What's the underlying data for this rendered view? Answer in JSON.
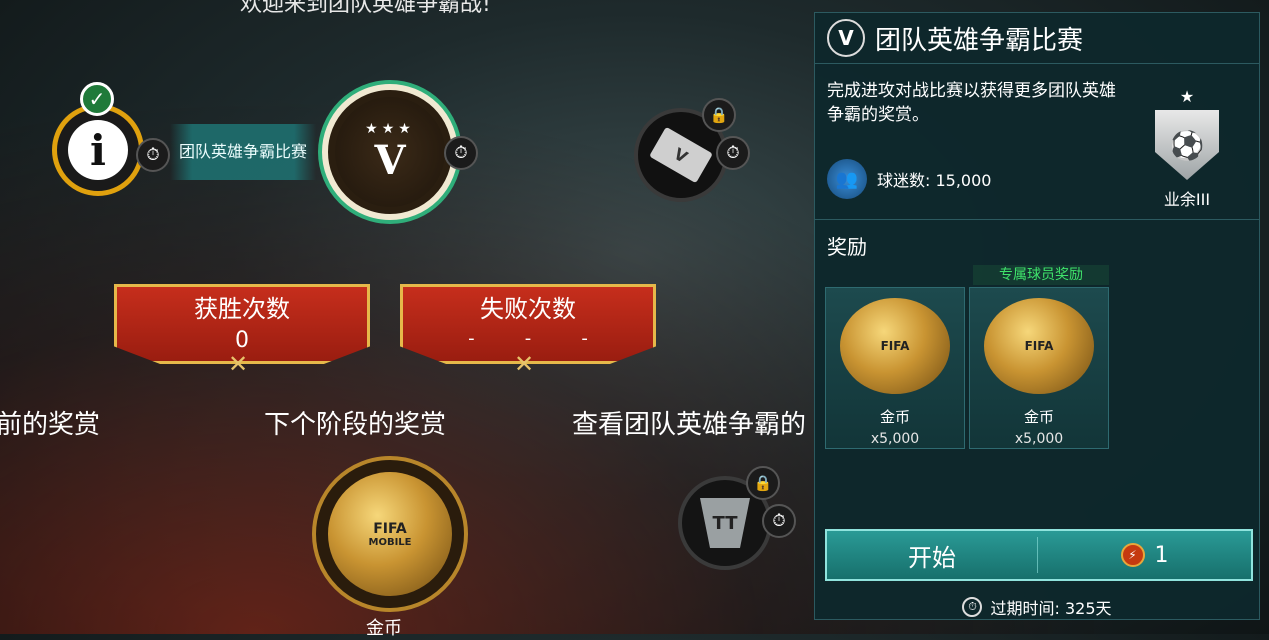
{
  "header": {
    "welcome": "欢迎来到团队英雄争霸战!"
  },
  "path": {
    "info_node": {
      "icon": "info-icon",
      "glyph": "i",
      "completed": true
    },
    "event_label": "团队英雄争霸比赛",
    "v_node": {
      "icon": "v-laurel-icon",
      "glyph": "V"
    },
    "ticket_node": {
      "icon": "ticket-icon",
      "locked": true
    },
    "tt_node": {
      "icon": "tt-crest-icon",
      "locked": true
    }
  },
  "stats": {
    "wins": {
      "label": "获胜次数",
      "value": "0"
    },
    "losses": {
      "label": "失败次数",
      "value": [
        "-",
        "-",
        "-"
      ]
    }
  },
  "sections": {
    "current_rewards_partial": "前的奖赏",
    "next_stage_rewards": "下个阶段的奖赏",
    "view_partial": "查看团队英雄争霸的"
  },
  "next_reward": {
    "name": "金币",
    "icon": "coins-icon"
  },
  "panel": {
    "title": "团队英雄争霸比赛",
    "description": "完成进攻对战比赛以获得更多团队英雄争霸的奖赏。",
    "fans_label": "球迷数: 15,000",
    "rank": {
      "stars": "★",
      "name": "业余III"
    },
    "rewards_title": "奖励",
    "exclusive_tag": "专属球员奖励",
    "rewards": [
      {
        "name": "金币",
        "qty": "x5,000"
      },
      {
        "name": "金币",
        "qty": "x5,000"
      }
    ],
    "start_label": "开始",
    "cost": "1",
    "expire_label": "过期时间: 325天"
  },
  "colors": {
    "accent_teal": "#17706c",
    "banner_red": "#c62e1c",
    "gold": "#e0a10e",
    "green_tag": "#3fe26a"
  }
}
